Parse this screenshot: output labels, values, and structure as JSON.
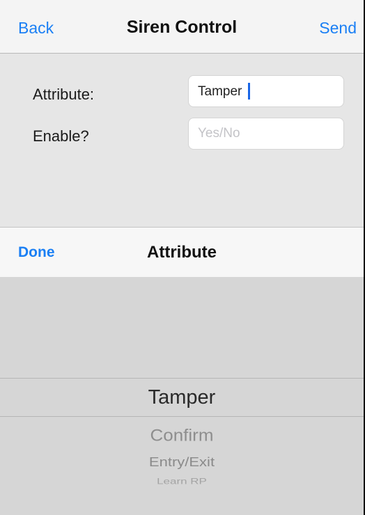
{
  "navbar": {
    "back_label": "Back",
    "title": "Siren Control",
    "send_label": "Send"
  },
  "form": {
    "attribute_label": "Attribute:",
    "attribute_value": "Tamper",
    "enable_label": "Enable?",
    "enable_placeholder": "Yes/No",
    "enable_value": ""
  },
  "toolbar": {
    "done_label": "Done",
    "title": "Attribute"
  },
  "picker": {
    "selected": "Tamper",
    "options_below": [
      "Confirm",
      "Entry/Exit",
      "Learn RP"
    ]
  },
  "colors": {
    "accent": "#1a7ff4",
    "cursor": "#1a66e6"
  }
}
